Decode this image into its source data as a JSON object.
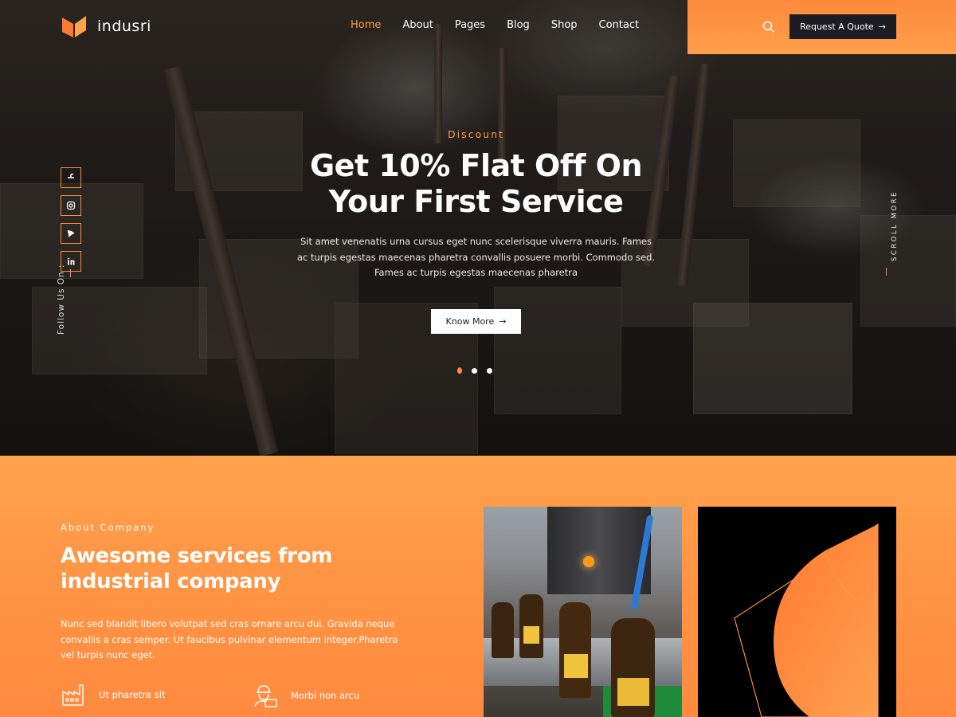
{
  "brand": {
    "name": "indusri",
    "accent": "#ff8a3d"
  },
  "nav": {
    "items": [
      {
        "label": "Home",
        "active": true
      },
      {
        "label": "About"
      },
      {
        "label": "Pages"
      },
      {
        "label": "Blog"
      },
      {
        "label": "Shop"
      },
      {
        "label": "Contact"
      }
    ],
    "quote_button": "Request A Quote",
    "quote_arrow": "→"
  },
  "hero": {
    "eyebrow": "Discount",
    "title": "Get 10% Flat Off On Your First Service",
    "description": "Sit amet venenatis urna cursus eget nunc scelerisque viverra mauris. Fames ac turpis egestas maecenas pharetra convallis posuere morbi. Commodo sed. Fames ac turpis egestas maecenas pharetra",
    "cta": "Know More",
    "cta_arrow": "→",
    "slides": 3,
    "active_slide": 1,
    "follow_label": "Follow Us On :",
    "scroll_label": "SCROLL MORE",
    "socials": [
      "facebook-icon",
      "instagram-icon",
      "dribbble-icon",
      "linkedin-icon"
    ]
  },
  "about": {
    "eyebrow": "About Company",
    "title": "Awesome services from industrial company",
    "description": "Nunc sed blandit libero volutpat sed cras ornare arcu dui. Gravida neque convallis a cras semper. Ut faucibus pulvinar elementum integer.Pharetra vel turpis nunc eget.",
    "features": [
      {
        "label": "Ut pharetra sit",
        "icon": "factory-icon"
      },
      {
        "label": "Morbi non arcu",
        "icon": "engineer-icon"
      }
    ]
  }
}
